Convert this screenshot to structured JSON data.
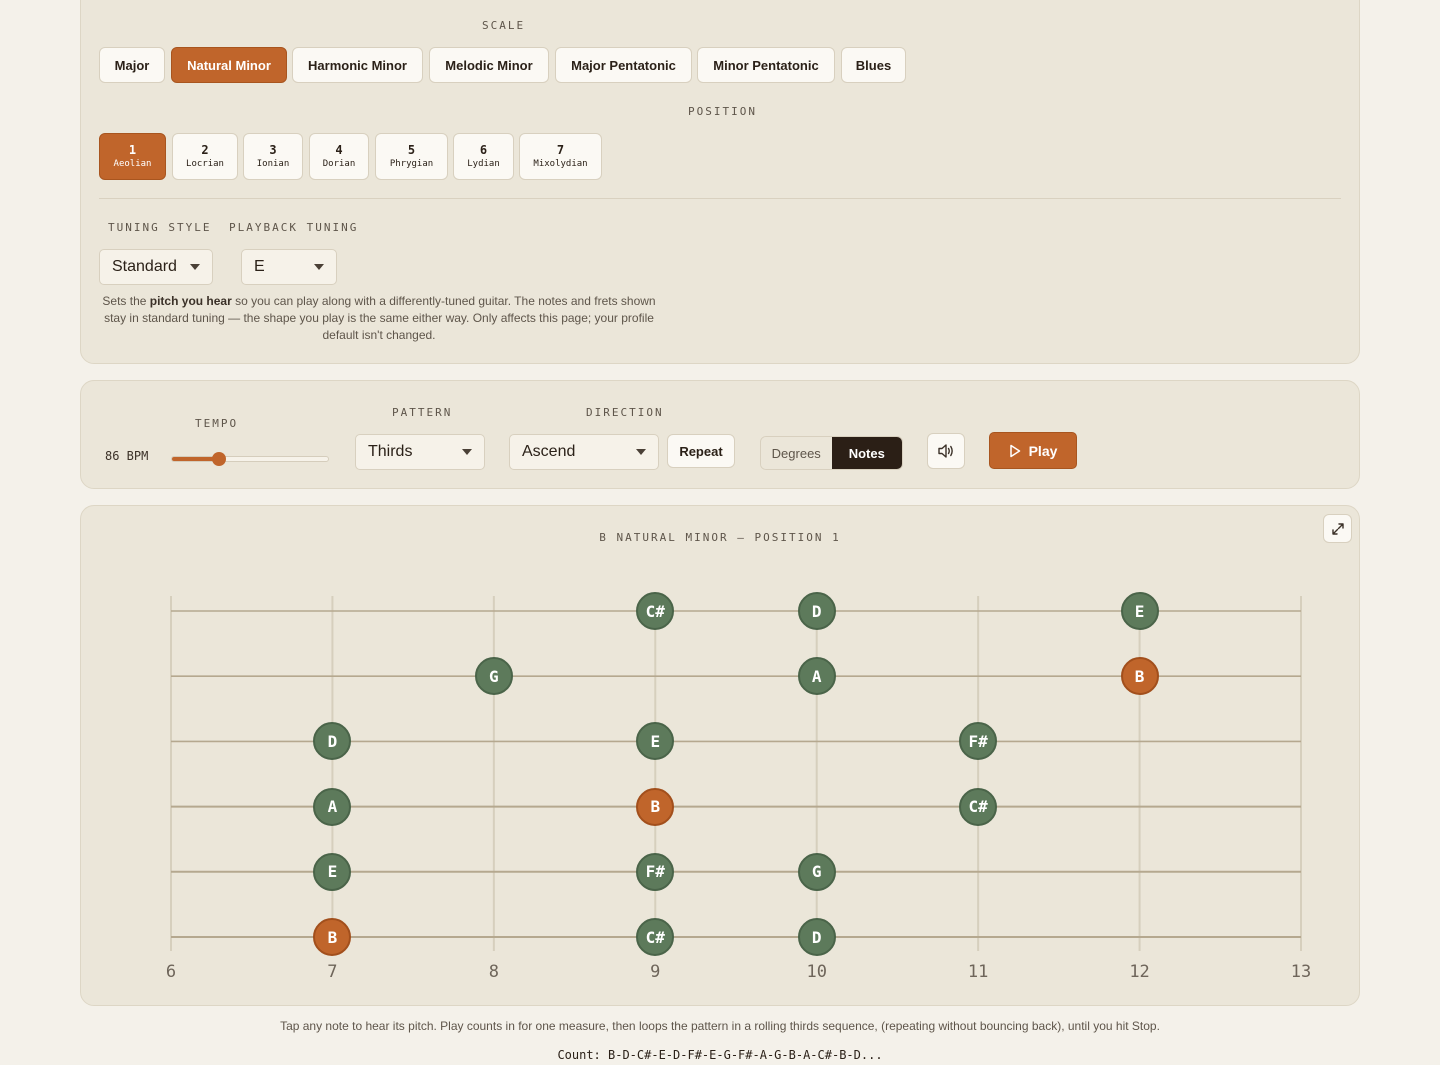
{
  "scale": {
    "label": "SCALE",
    "options": [
      {
        "label": "Major",
        "active": false
      },
      {
        "label": "Natural Minor",
        "active": true
      },
      {
        "label": "Harmonic Minor",
        "active": false
      },
      {
        "label": "Melodic Minor",
        "active": false
      },
      {
        "label": "Major Pentatonic",
        "active": false
      },
      {
        "label": "Minor Pentatonic",
        "active": false
      },
      {
        "label": "Blues",
        "active": false
      }
    ]
  },
  "position": {
    "label": "POSITION",
    "options": [
      {
        "num": "1",
        "mode": "Aeolian",
        "active": true
      },
      {
        "num": "2",
        "mode": "Locrian",
        "active": false
      },
      {
        "num": "3",
        "mode": "Ionian",
        "active": false
      },
      {
        "num": "4",
        "mode": "Dorian",
        "active": false
      },
      {
        "num": "5",
        "mode": "Phrygian",
        "active": false
      },
      {
        "num": "6",
        "mode": "Lydian",
        "active": false
      },
      {
        "num": "7",
        "mode": "Mixolydian",
        "active": false
      }
    ]
  },
  "tuning": {
    "style_label": "TUNING STYLE",
    "style_value": "Standard",
    "playback_label": "PLAYBACK TUNING",
    "playback_value": "E",
    "help_pre": "Sets the ",
    "help_bold": "pitch you hear",
    "help_post": " so you can play along with a differently-tuned guitar. The notes and frets shown stay in standard tuning — the shape you play is the same either way. Only affects this page; your profile default isn't changed."
  },
  "controls": {
    "tempo_label": "TEMPO",
    "tempo_value": "86 BPM",
    "tempo_fraction": 0.3,
    "pattern_label": "PATTERN",
    "pattern_value": "Thirds",
    "direction_label": "DIRECTION",
    "direction_value": "Ascend",
    "repeat_label": "Repeat",
    "view_options": [
      {
        "label": "Degrees",
        "active": false
      },
      {
        "label": "Notes",
        "active": true
      }
    ],
    "sound_icon": "speaker-icon",
    "play_label": "Play",
    "play_icon": "play-icon"
  },
  "fretboard": {
    "title": "B NATURAL MINOR — POSITION 1",
    "expand_icon": "expand-icon",
    "first_fret": 6,
    "last_fret": 13,
    "fret_labels": [
      "6",
      "7",
      "8",
      "9",
      "10",
      "11",
      "12",
      "13"
    ],
    "notes": [
      {
        "string": 1,
        "fret": 9,
        "note": "C#",
        "root": false
      },
      {
        "string": 1,
        "fret": 10,
        "note": "D",
        "root": false
      },
      {
        "string": 1,
        "fret": 12,
        "note": "E",
        "root": false
      },
      {
        "string": 2,
        "fret": 8,
        "note": "G",
        "root": false
      },
      {
        "string": 2,
        "fret": 10,
        "note": "A",
        "root": false
      },
      {
        "string": 2,
        "fret": 12,
        "note": "B",
        "root": true
      },
      {
        "string": 3,
        "fret": 7,
        "note": "D",
        "root": false
      },
      {
        "string": 3,
        "fret": 9,
        "note": "E",
        "root": false
      },
      {
        "string": 3,
        "fret": 11,
        "note": "F#",
        "root": false
      },
      {
        "string": 4,
        "fret": 7,
        "note": "A",
        "root": false
      },
      {
        "string": 4,
        "fret": 9,
        "note": "B",
        "root": true
      },
      {
        "string": 4,
        "fret": 11,
        "note": "C#",
        "root": false
      },
      {
        "string": 5,
        "fret": 7,
        "note": "E",
        "root": false
      },
      {
        "string": 5,
        "fret": 9,
        "note": "F#",
        "root": false
      },
      {
        "string": 5,
        "fret": 10,
        "note": "G",
        "root": false
      },
      {
        "string": 6,
        "fret": 7,
        "note": "B",
        "root": true
      },
      {
        "string": 6,
        "fret": 9,
        "note": "C#",
        "root": false
      },
      {
        "string": 6,
        "fret": 10,
        "note": "D",
        "root": false
      }
    ]
  },
  "footer": {
    "help": "Tap any note to hear its pitch. Play counts in for one measure, then loops the pattern in a rolling thirds sequence, (repeating without bouncing back), until you hit Stop.",
    "count": "Count: B-D-C#-E-D-F#-E-G-F#-A-G-B-A-C#-B-D..."
  },
  "colors": {
    "accent": "#c0652b",
    "scale_note": "#5d7a5b",
    "dark": "#2b1f16"
  }
}
